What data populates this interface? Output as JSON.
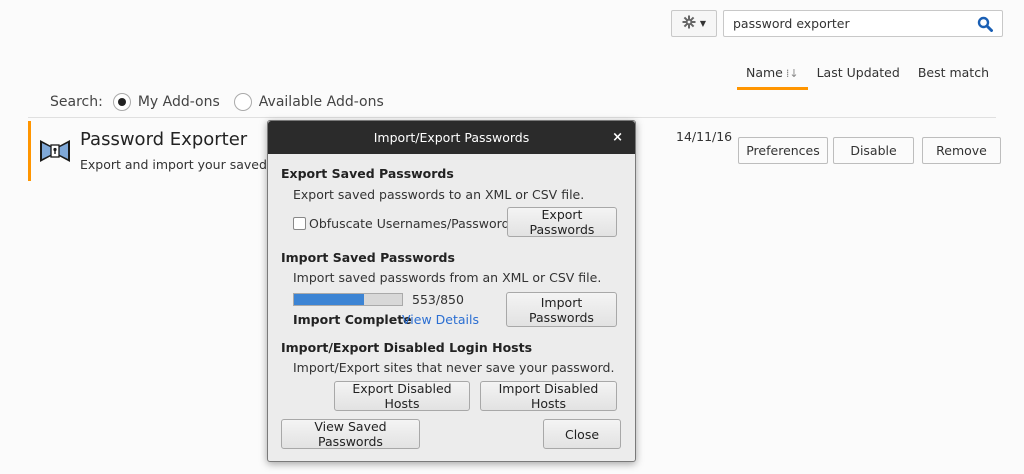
{
  "toolbar": {
    "gear_icon": "gear-icon",
    "search_value": "password exporter",
    "search_icon": "magnifier-icon",
    "accent": "#1a5fb4"
  },
  "sort": {
    "items": [
      {
        "label": "Name",
        "active": true
      },
      {
        "label": "Last Updated",
        "active": false
      },
      {
        "label": "Best match",
        "active": false
      }
    ],
    "accent": "#ff9500"
  },
  "scope": {
    "label": "Search:",
    "options": [
      {
        "label": "My Add-ons",
        "selected": true
      },
      {
        "label": "Available Add-ons",
        "selected": false
      }
    ]
  },
  "addon": {
    "name": "Password Exporter",
    "description": "Export and import your saved passwords",
    "date": "14/11/16",
    "buttons": {
      "preferences": "Preferences",
      "disable": "Disable",
      "remove": "Remove"
    }
  },
  "dialog": {
    "title": "Import/Export Passwords",
    "close_glyph": "×",
    "export": {
      "heading": "Export Saved Passwords",
      "text": "Export saved passwords to an XML or CSV file.",
      "checkbox_label": "Obfuscate Usernames/Passwords",
      "checkbox_checked": false,
      "button": "Export Passwords"
    },
    "import": {
      "heading": "Import Saved Passwords",
      "text": "Import saved passwords from an XML or CSV file.",
      "progress_done": 553,
      "progress_total": 850,
      "progress_text": "553/850",
      "status": "Import Complete",
      "details_link": "View Details",
      "button": "Import Passwords"
    },
    "hosts": {
      "heading": "Import/Export Disabled Login Hosts",
      "text": "Import/Export sites that never save your password.",
      "export_button": "Export Disabled Hosts",
      "import_button": "Import Disabled Hosts"
    },
    "view_saved_button": "View Saved Passwords",
    "close_button": "Close"
  }
}
